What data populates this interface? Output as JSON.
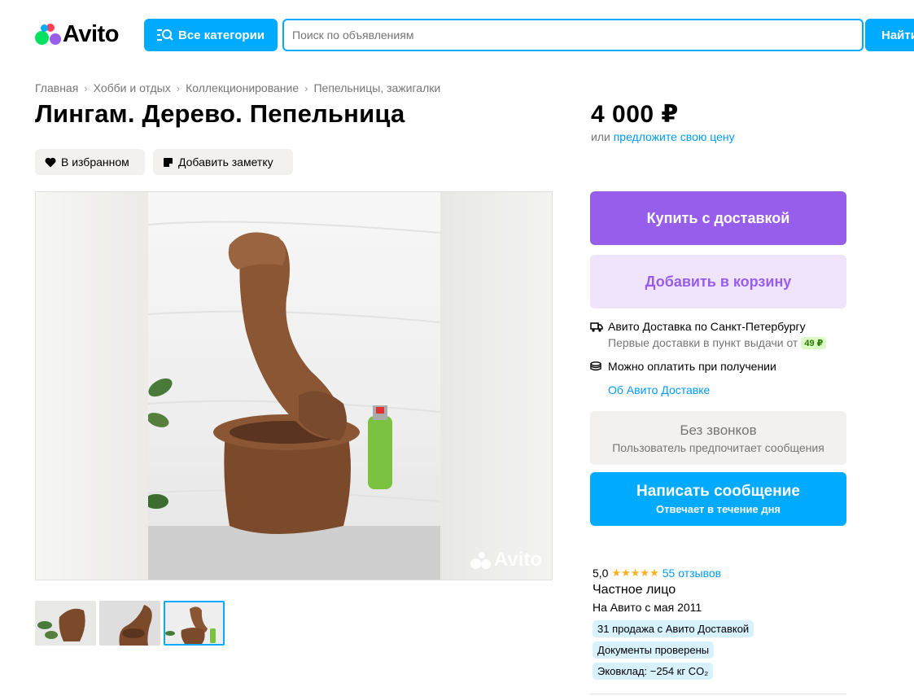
{
  "header": {
    "logo_text": "Avito",
    "categories_label": "Все категории",
    "search_placeholder": "Поиск по объявлениям",
    "find_label": "Найти"
  },
  "breadcrumb": [
    "Главная",
    "Хобби и отдых",
    "Коллекционирование",
    "Пепельницы, зажигалки"
  ],
  "listing": {
    "title": "Лингам. Дерево. Пепельница",
    "favorite_label": "В избранном",
    "note_label": "Добавить заметку",
    "price": "4 000 ₽",
    "price_or": "или",
    "price_offer_link": "предложите свою цену",
    "watermark": "Avito",
    "thumbnails_count": 3,
    "active_thumbnail": 3
  },
  "actions": {
    "buy_label": "Купить с доставкой",
    "cart_label": "Добавить в корзину",
    "delivery_title": "Авито Доставка по Санкт-Петербургу",
    "delivery_sub": "Первые доставки в пункт выдачи от",
    "delivery_price": "49 ₽",
    "pay_on_receipt": "Можно оплатить при получении",
    "about_delivery_link": "Об Авито Доставке",
    "nocall_title": "Без звонков",
    "nocall_sub": "Пользователь предпочитает сообщения",
    "message_title": "Написать сообщение",
    "message_sub": "Отвечает в течение дня"
  },
  "seller": {
    "rating": "5,0",
    "stars": "★★★★★",
    "reviews": "55 отзывов",
    "name": "Частное лицо",
    "since": "На Авито с мая 2011",
    "tags": [
      "31 продажа с Авито Доставкой",
      "Документы проверены",
      "Эковклад: −254 кг CO₂"
    ]
  },
  "colors": {
    "brand_blue": "#00aaff",
    "purple": "#965eeb",
    "purple_light": "#f0e4fd",
    "link_blue": "#0099f7"
  },
  "icons": [
    "avito-logo-dots",
    "categories-search-icon",
    "heart-icon",
    "note-icon",
    "truck-icon",
    "coins-icon"
  ]
}
